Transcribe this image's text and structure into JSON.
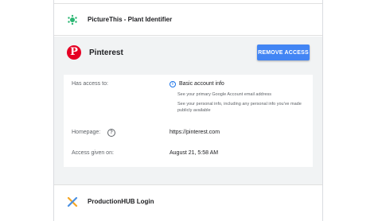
{
  "apps": [
    {
      "name": "PictureThis - Plant Identifier",
      "icon": "plant-leaf-icon"
    },
    {
      "name": "ProductionHUB Login",
      "icon": "productionhub-x-icon"
    }
  ],
  "expanded": {
    "icon": "pinterest-logo",
    "title": "Pinterest",
    "remove_label": "REMOVE ACCESS",
    "has_access_label": "Has access to:",
    "access_title": "Basic account info",
    "access_desc_1": "See your primary Google Account email address",
    "access_desc_2": "See your personal info, including any personal info you've made publicly available",
    "homepage_label": "Homepage:",
    "homepage_value": "https://pinterest.com",
    "access_given_label": "Access given on:",
    "access_given_value": "August 21, 5:58 AM"
  },
  "colors": {
    "accent": "#4285f4",
    "pinterest": "#e60023",
    "expanded_bg": "#f1f3f4"
  }
}
